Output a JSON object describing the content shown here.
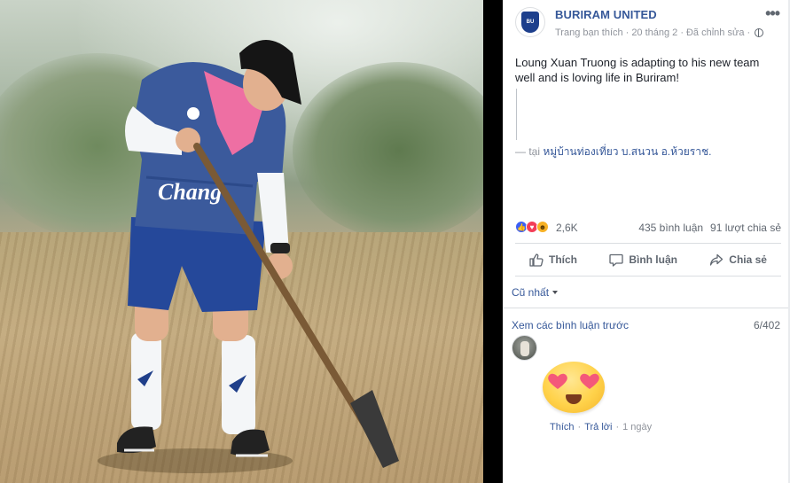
{
  "photo": {
    "alt_icon": "photo-footballer-digging"
  },
  "post": {
    "page_name": "BURIRAM UNITED",
    "meta_liked": "Trang bạn thích",
    "meta_dot": "·",
    "meta_date": "20 tháng 2",
    "meta_edited": "Đã chỉnh sửa",
    "text": "Loung Xuan Truong is adapting to his new team well and is loving life in Buriram!",
    "location_prefix": "— tại",
    "location_place": "หมู่บ้านท่องเที่ยว บ.สนวน อ.ห้วยราช."
  },
  "reactions": {
    "count": "2,6K",
    "comments": "435 bình luận",
    "shares": "91 lượt chia sẻ"
  },
  "actions": {
    "like": "Thích",
    "comment": "Bình luận",
    "share": "Chia sẻ"
  },
  "comments": {
    "sort_label": "Cũ nhất",
    "previous_link": "Xem các bình luận trước",
    "counter": "6/402",
    "item": {
      "like": "Thích",
      "reply": "Trả lời",
      "dot": "·",
      "time": "1 ngày"
    }
  },
  "colors": {
    "link": "#365899",
    "like_blue": "#3b5ff5",
    "love_red": "#f33e58",
    "haha_yellow": "#f7b125"
  }
}
